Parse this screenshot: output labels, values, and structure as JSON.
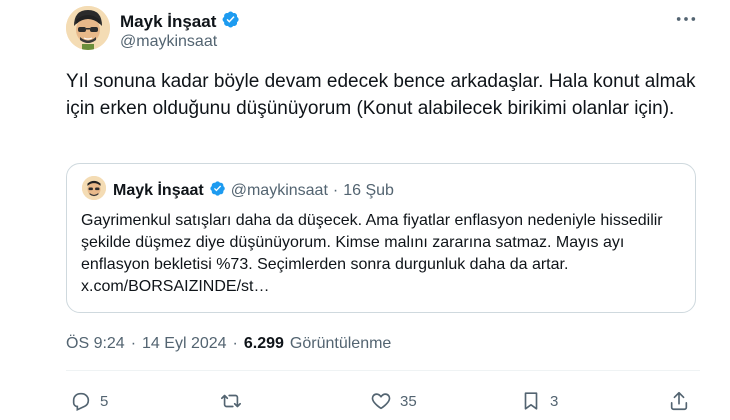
{
  "author": {
    "display_name": "Mayk İnşaat",
    "handle": "@maykinsaat",
    "avatar_icon": "cartoon-man-avatar",
    "verified_icon": "verified-badge-icon"
  },
  "more_icon": "more-horizontal-icon",
  "tweet": {
    "text": "Yıl sonuna kadar böyle devam edecek bence arkadaşlar.  Hala konut almak için erken olduğunu düşünüyorum (Konut alabilecek birikimi olanlar için)."
  },
  "quote": {
    "display_name": "Mayk İnşaat",
    "handle": "@maykinsaat",
    "separator": "·",
    "date": "16 Şub",
    "text": "Gayrimenkul satışları daha da düşecek. Ama fiyatlar enflasyon nedeniyle hissedilir şekilde düşmez diye düşünüyorum. Kimse malını zararına satmaz. Mayıs ayı enflasyon bekletisi %73. Seçimlerden sonra durgunluk daha da artar. x.com/BORSAIZINDE/st…"
  },
  "meta": {
    "time": "ÖS 9:24",
    "sep1": "·",
    "date": "14 Eyl 2024",
    "sep2": "·",
    "views_count": "6.299",
    "views_label": "Görüntülenme"
  },
  "actions": {
    "reply_count": "5",
    "retweet_count": "",
    "like_count": "35",
    "bookmark_count": "3"
  },
  "colors": {
    "text": "#0f1419",
    "muted": "#536471",
    "verified": "#1d9bf0",
    "border": "#cfd9de"
  }
}
